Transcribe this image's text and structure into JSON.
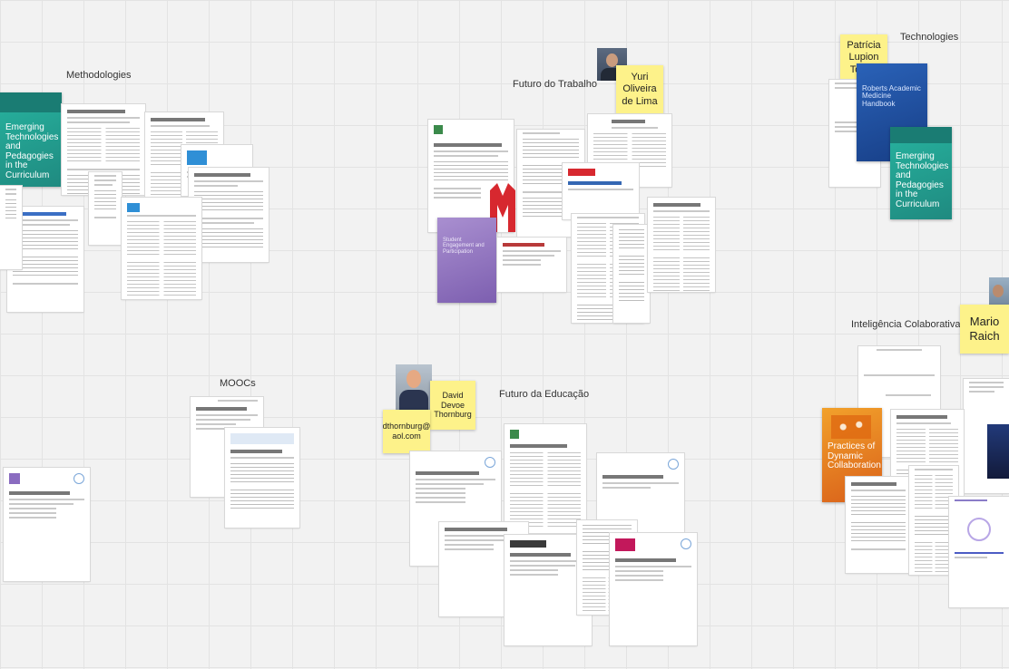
{
  "frames": {
    "methodologies": "Methodologies",
    "futuro_trabalho": "Futuro do Trabalho",
    "technologies": "Technologies",
    "inteligencia": "Inteligência Colaborativa",
    "moocs": "MOOCs",
    "futuro_educacao": "Futuro da Educação"
  },
  "stickies": {
    "yuri": "Yuri\nOliveira\nde Lima",
    "patricia": "Patrícia\nLupion\nTorres",
    "mario": "Mario\nRaich",
    "david": "David\nDevoe\nThornburg",
    "email": "dthornburg@\naol.com"
  },
  "books": {
    "emerging_left": "Emerging Technologies and Pedagogies in the Curriculum",
    "emerging_right": "Emerging Technologies and Pedagogies in the Curriculum",
    "roberts": "Roberts Academic Medicine Handbook",
    "dynamic": "Practices of Dynamic Collaboration",
    "purple": "Student Engagement and Participation"
  },
  "colors": {
    "sticky": "#fdf28a",
    "teal_book": "#1f9a8e",
    "blue_book": "#1d4f9a",
    "orange_book": "#e5801f",
    "purple_book": "#8e6cb8",
    "red_logo": "#d7282f"
  }
}
